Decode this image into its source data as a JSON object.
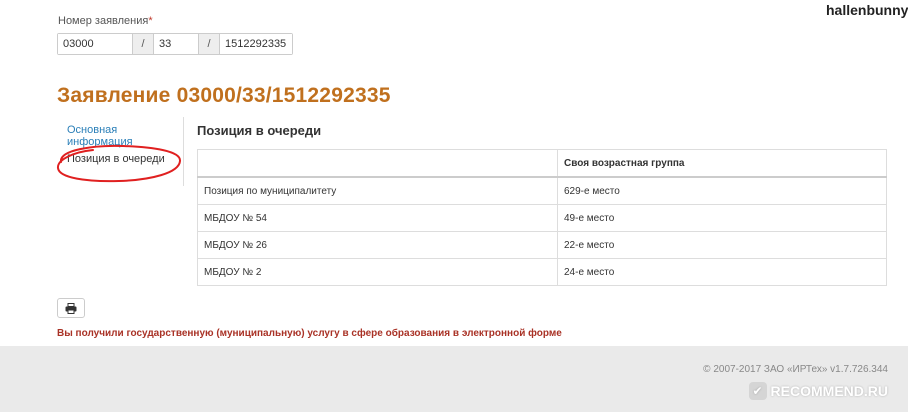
{
  "watermark": {
    "username": "hallenbunny"
  },
  "application_number": {
    "label": "Номер заявления",
    "required_mark": "*",
    "part1": "03000",
    "sep1": "/",
    "part2": "33",
    "sep2": "/",
    "part3": "1512292335"
  },
  "title": "Заявление 03000/33/1512292335",
  "tabs": [
    {
      "label": "Основная информация"
    },
    {
      "label": "Позиция в очереди"
    }
  ],
  "section": {
    "title": "Позиция в очереди",
    "table": {
      "headers": [
        "",
        "Своя возрастная группа"
      ],
      "rows": [
        [
          "Позиция по муниципалитету",
          "629-е место"
        ],
        [
          "МБДОУ № 54",
          "49-е место"
        ],
        [
          "МБДОУ № 26",
          "22-е место"
        ],
        [
          "МБДОУ № 2",
          "24-е место"
        ]
      ]
    }
  },
  "print_icon": "printer-icon",
  "notice": "Вы получили государственную (муниципальную) услугу в сфере образования в электронной форме",
  "footer": {
    "copyright": "© 2007-2017 ЗАО «ИРТех» v1.7.726.344",
    "recommend": "RECOMMEND.RU"
  },
  "colors": {
    "title": "#c0701e",
    "link": "#2a7fb8",
    "notice": "#a93226",
    "annotation": "#e02020"
  }
}
